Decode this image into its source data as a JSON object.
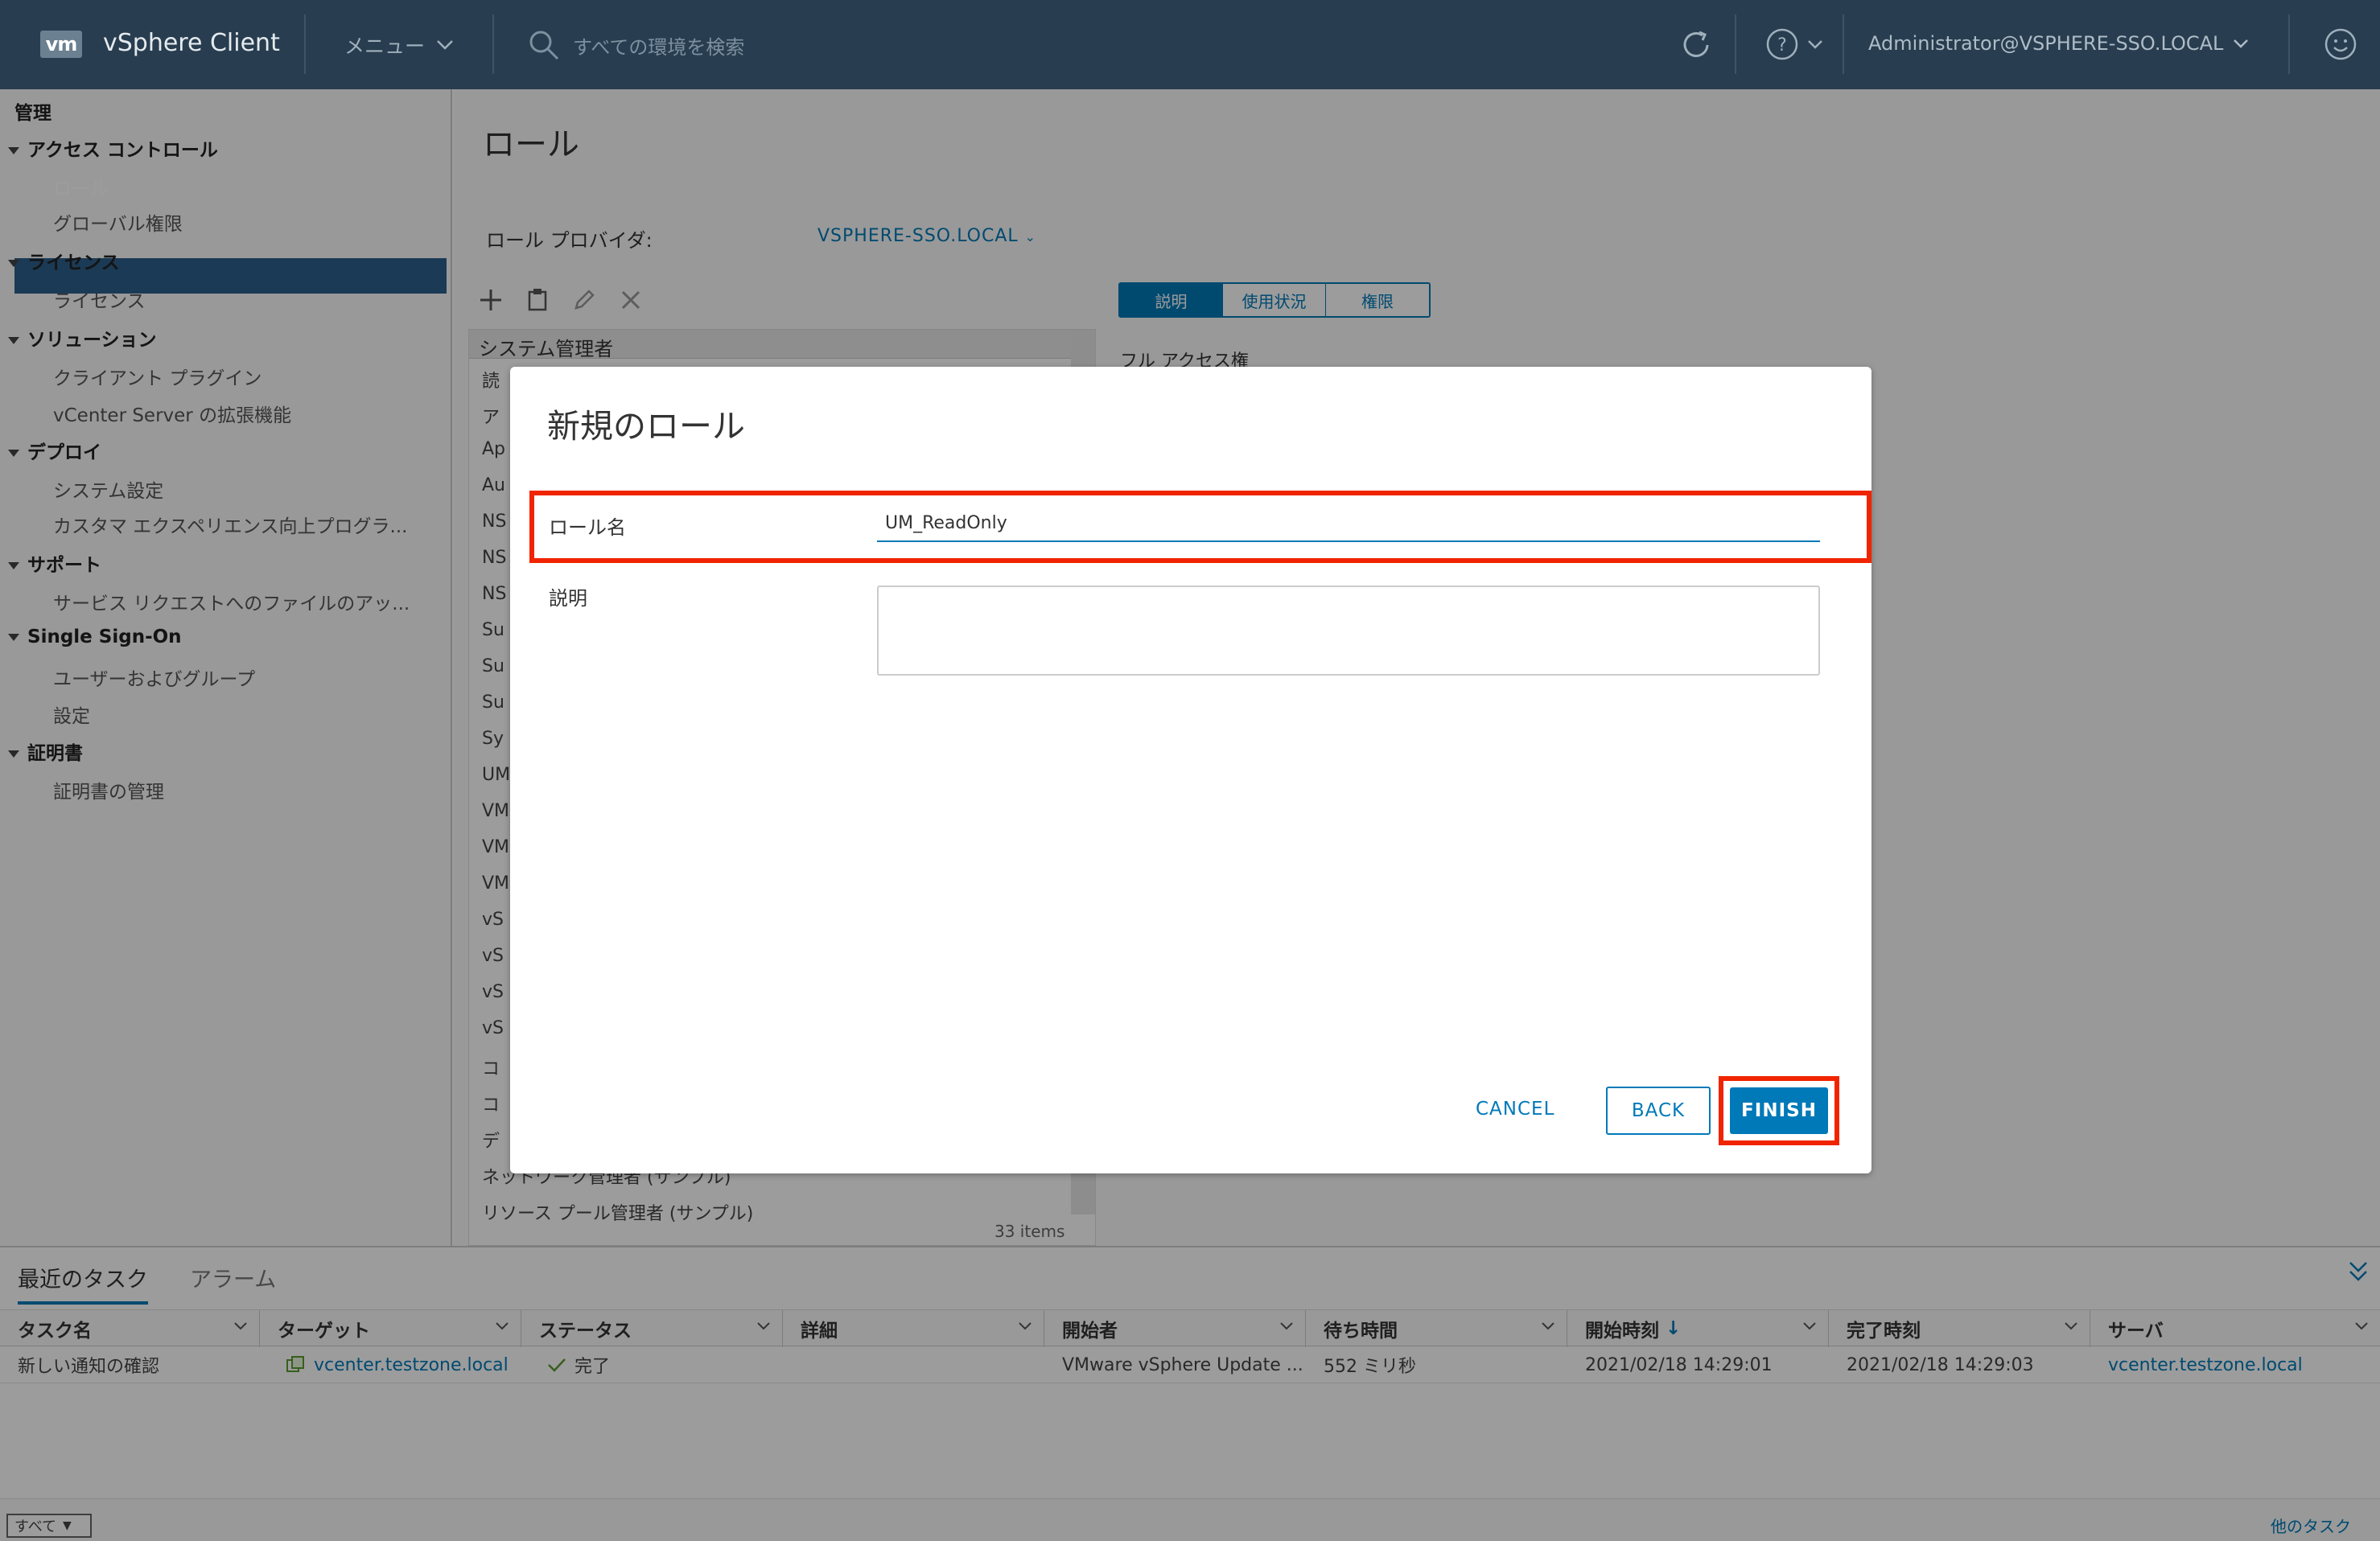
{
  "header": {
    "logo": "vm",
    "app_title": "vSphere Client",
    "menu_label": "メニュー",
    "search_placeholder": "すべての環境を検索",
    "user": "Administrator@VSPHERE-SSO.LOCAL"
  },
  "sidebar": {
    "heading": "管理",
    "sections": [
      {
        "label": "アクセス コントロール",
        "items": [
          "ロール",
          "グローバル権限"
        ]
      },
      {
        "label": "ライセンス",
        "items": [
          "ライセンス"
        ]
      },
      {
        "label": "ソリューション",
        "items": [
          "クライアント プラグイン",
          "vCenter Server の拡張機能"
        ]
      },
      {
        "label": "デプロイ",
        "items": [
          "システム設定",
          "カスタマ エクスペリエンス向上プログラ..."
        ]
      },
      {
        "label": "サポート",
        "items": [
          "サービス リクエストへのファイルのアッ..."
        ]
      },
      {
        "label": "Single Sign-On",
        "items": [
          "ユーザーおよびグループ",
          "設定"
        ]
      },
      {
        "label": "証明書",
        "items": [
          "証明書の管理"
        ]
      }
    ],
    "active_item": "ロール"
  },
  "main": {
    "title": "ロール",
    "provider_label": "ロール プロバイダ:",
    "provider_value": "VSPHERE-SSO.LOCAL",
    "roles_visible": [
      "システム管理者",
      "読",
      "ア",
      "Ap",
      "Au",
      "NS",
      "NS",
      "NS",
      "Su",
      "Su",
      "Su",
      "Sy",
      "UM",
      "VM",
      "VM",
      "VM",
      "vS",
      "vS",
      "vS",
      "vS",
      "コ",
      "コ",
      "デ",
      "ネットワーク管理者 (サンプル)",
      "リソース プール管理者 (サンプル)"
    ],
    "items_count": "33 items",
    "tabs": [
      "説明",
      "使用状況",
      "権限"
    ],
    "active_tab": "説明",
    "description_snippet": "フル アクセス権"
  },
  "dialog": {
    "title": "新規のロール",
    "name_label": "ロール名",
    "name_value": "UM_ReadOnly",
    "description_label": "説明",
    "description_value": "",
    "cancel": "CANCEL",
    "back": "BACK",
    "finish": "FINISH",
    "highlight_color": "#f12400"
  },
  "tasks": {
    "tabs": [
      "最近のタスク",
      "アラーム"
    ],
    "active_tab": "最近のタスク",
    "columns": [
      "タスク名",
      "ターゲット",
      "ステータス",
      "詳細",
      "開始者",
      "待ち時間",
      "開始時刻",
      "完了時刻",
      "サーバ"
    ],
    "rows": [
      {
        "task": "新しい通知の確認",
        "target": "vcenter.testzone.local",
        "status": "完了",
        "detail": "",
        "initiator": "VMware vSphere Update ...",
        "queued": "552 ミリ秒",
        "start": "2021/02/18 14:29:01",
        "end": "2021/02/18 14:29:03",
        "server": "vcenter.testzone.local"
      }
    ],
    "filter": "すべて",
    "more": "他のタスク"
  },
  "colors": {
    "header_bg": "#283d4f",
    "accent": "#0079b8",
    "nav_active": "#2d5f8b"
  }
}
